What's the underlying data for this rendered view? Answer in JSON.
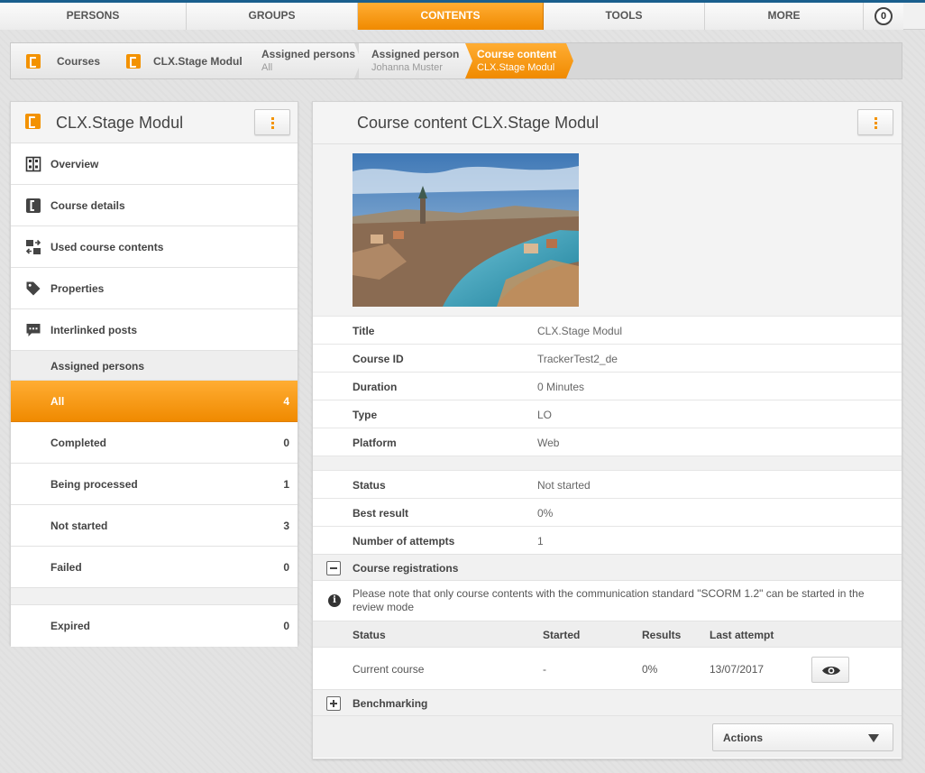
{
  "topnav": {
    "tabs": [
      {
        "label": "PERSONS"
      },
      {
        "label": "GROUPS"
      },
      {
        "label": "CONTENTS"
      },
      {
        "label": "TOOLS"
      },
      {
        "label": "MORE"
      }
    ],
    "notifications": "0",
    "accent_color": "#f39200"
  },
  "breadcrumb": {
    "items": [
      {
        "label": "Courses"
      },
      {
        "label": "CLX.Stage Modul"
      },
      {
        "label": "Assigned persons",
        "sub": "All"
      },
      {
        "label": "Assigned person",
        "sub": "Johanna Muster"
      },
      {
        "label": "Course content",
        "sub": "CLX.Stage Modul"
      }
    ]
  },
  "sidebar": {
    "title": "CLX.Stage Modul",
    "items": [
      {
        "label": "Overview",
        "icon": "overview-grid-icon"
      },
      {
        "label": "Course details",
        "icon": "course-icon"
      },
      {
        "label": "Used course contents",
        "icon": "contents-icon"
      },
      {
        "label": "Properties",
        "icon": "tag-icon"
      },
      {
        "label": "Interlinked posts",
        "icon": "comment-icon"
      }
    ],
    "assigned_header": "Assigned persons",
    "filters": [
      {
        "label": "All",
        "count": "4"
      },
      {
        "label": "Completed",
        "count": "0"
      },
      {
        "label": "Being processed",
        "count": "1"
      },
      {
        "label": "Not started",
        "count": "3"
      },
      {
        "label": "Failed",
        "count": "0"
      }
    ],
    "expired": {
      "label": "Expired",
      "count": "0"
    }
  },
  "main": {
    "title": "Course content CLX.Stage Modul",
    "details": [
      {
        "key": "Title",
        "value": "CLX.Stage Modul"
      },
      {
        "key": "Course ID",
        "value": "TrackerTest2_de"
      },
      {
        "key": "Duration",
        "value": "0 Minutes"
      },
      {
        "key": "Type",
        "value": "LO"
      },
      {
        "key": "Platform",
        "value": "Web"
      }
    ],
    "status": [
      {
        "key": "Status",
        "value": "Not started"
      },
      {
        "key": "Best result",
        "value": "0%"
      },
      {
        "key": "Number of attempts",
        "value": "1"
      }
    ],
    "registrations": {
      "label": "Course registrations",
      "note": "Please note that only course contents with the communication standard \"SCORM 1.2\" can be started in the review mode",
      "columns": [
        "Status",
        "Started",
        "Results",
        "Last attempt"
      ],
      "rows": [
        {
          "status": "Current course",
          "started": "-",
          "results": "0%",
          "last_attempt": "13/07/2017"
        }
      ]
    },
    "benchmarking": {
      "label": "Benchmarking"
    },
    "actions": {
      "label": "Actions"
    }
  }
}
